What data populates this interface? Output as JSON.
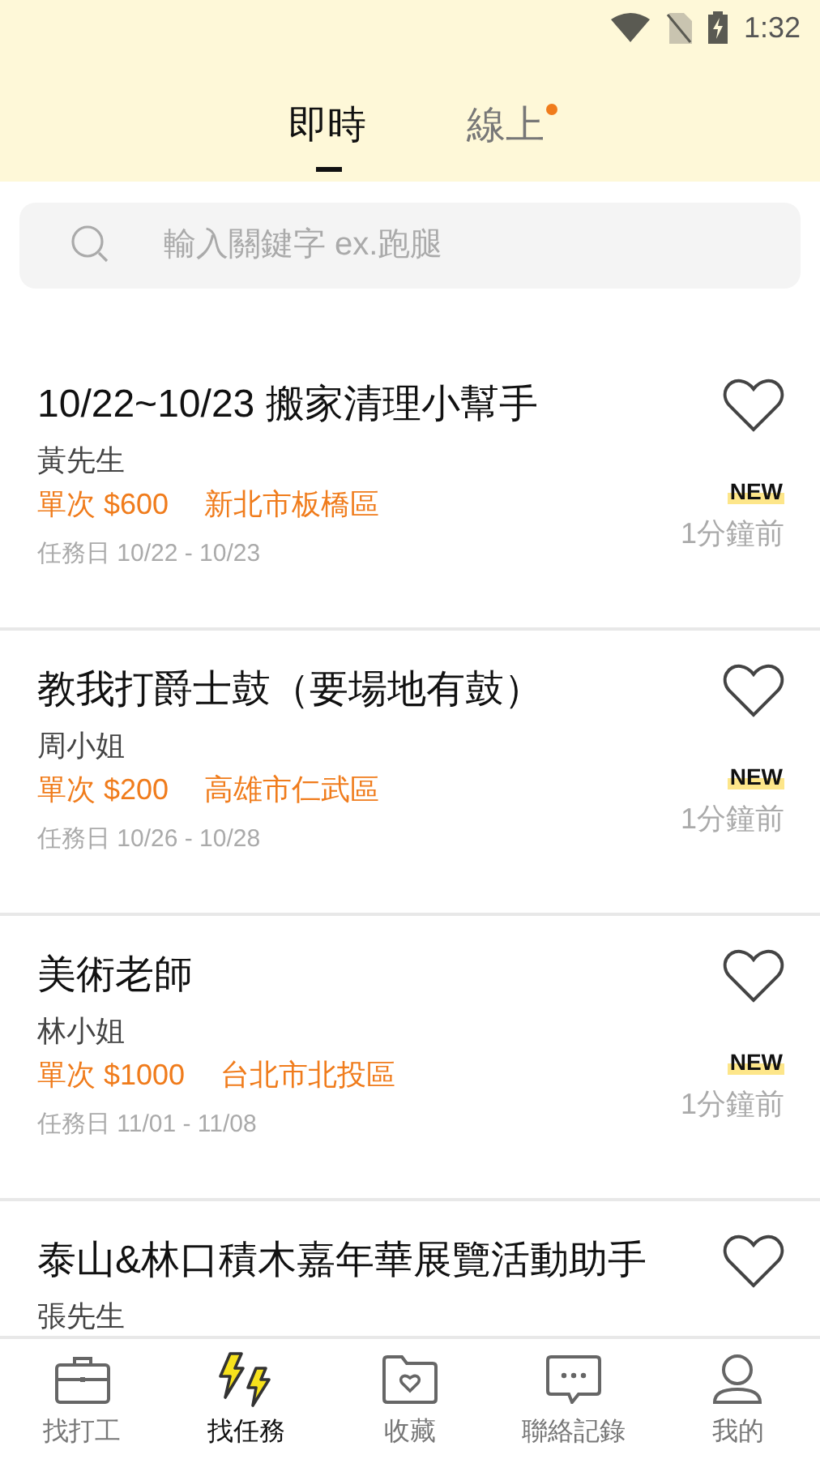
{
  "status_bar": {
    "time": "1:32"
  },
  "tabs": [
    {
      "label": "即時",
      "selected": true,
      "has_dot": false
    },
    {
      "label": "線上",
      "selected": false,
      "has_dot": true
    }
  ],
  "search": {
    "placeholder": "輸入關鍵字 ex.跑腿"
  },
  "jobs": [
    {
      "title": "10/22~10/23 搬家清理小幫手",
      "poster": "黃先生",
      "pay": "單次 $600",
      "location": "新北市板橋區",
      "dates": "任務日 10/22 - 10/23",
      "badge": "NEW",
      "posted": "1分鐘前",
      "favorited": false
    },
    {
      "title": "教我打爵士鼓（要場地有鼓）",
      "poster": "周小姐",
      "pay": "單次 $200",
      "location": "高雄市仁武區",
      "dates": "任務日 10/26 - 10/28",
      "badge": "NEW",
      "posted": "1分鐘前",
      "favorited": false
    },
    {
      "title": "美術老師",
      "poster": "林小姐",
      "pay": "單次 $1000",
      "location": "台北市北投區",
      "dates": "任務日 11/01 - 11/08",
      "badge": "NEW",
      "posted": "1分鐘前",
      "favorited": false
    },
    {
      "title": "泰山&林口積木嘉年華展覽活動助手",
      "poster": "張先生",
      "favorited": false
    }
  ],
  "bottom_nav": [
    {
      "kind": "briefcase",
      "label": "找打工",
      "selected": false
    },
    {
      "kind": "bolts",
      "label": "找任務",
      "selected": true
    },
    {
      "kind": "folder",
      "label": "收藏",
      "selected": false
    },
    {
      "kind": "chat",
      "label": "聯絡記錄",
      "selected": false
    },
    {
      "kind": "person",
      "label": "我的",
      "selected": false
    }
  ]
}
